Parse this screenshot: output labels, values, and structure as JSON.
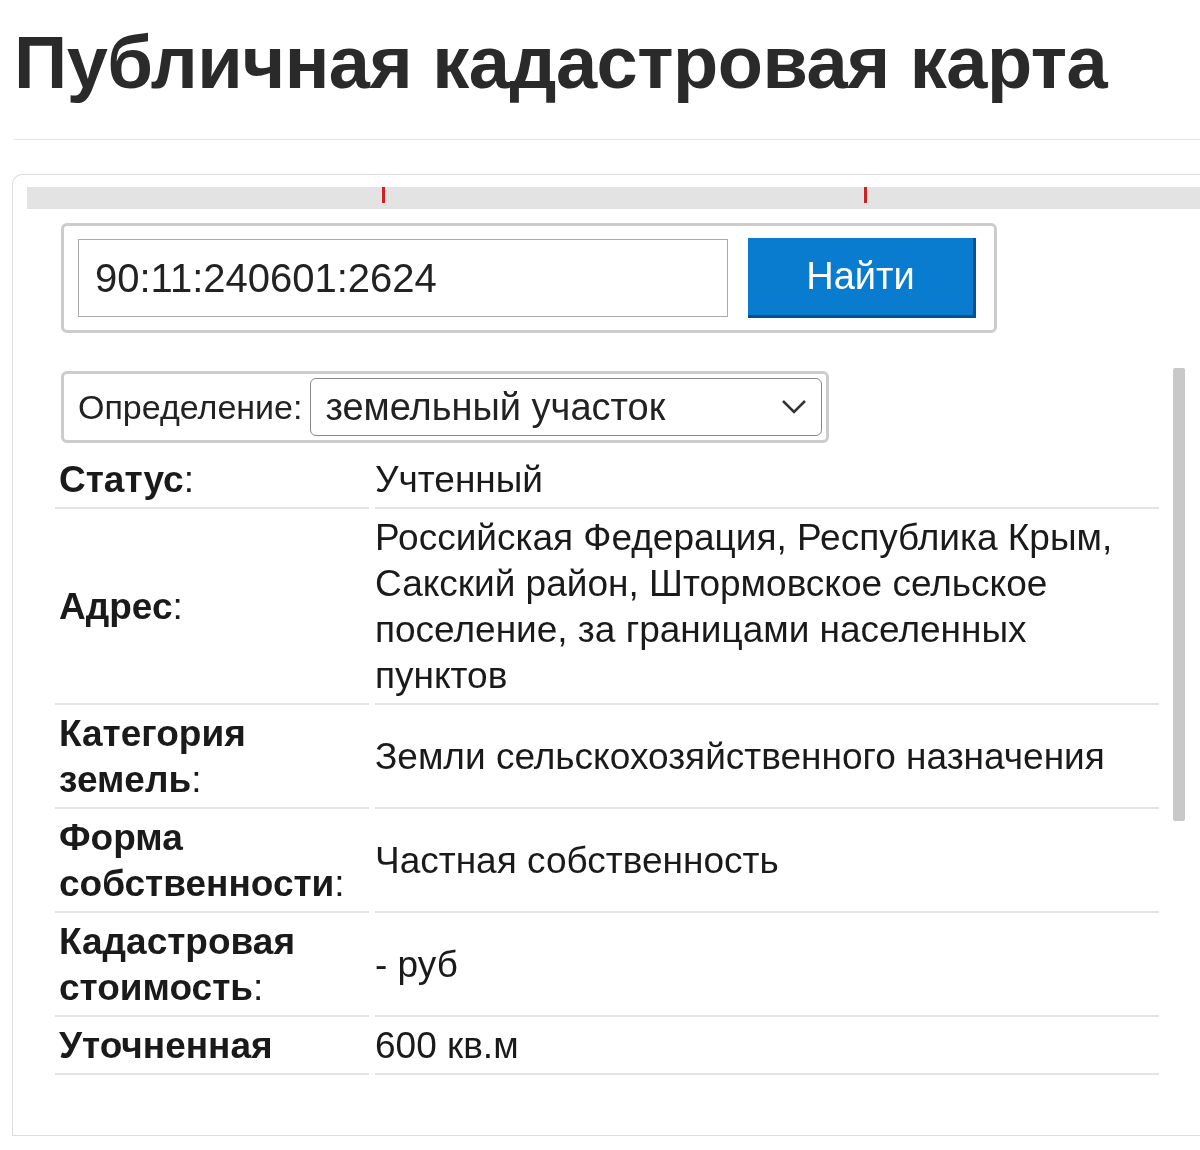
{
  "page": {
    "title": "Публичная кадастровая карта"
  },
  "search": {
    "value": "90:11:240601:2624",
    "button": "Найти"
  },
  "definition": {
    "label": "Определение:",
    "value": "земельный участок"
  },
  "rows": [
    {
      "label": "**Статус**:",
      "value": "Учтенный"
    },
    {
      "label": "**Адрес**:",
      "value": "Российская Федерация, Республика Крым, Сакский район, Штормовское сельское поселение, за границами населенных пунктов"
    },
    {
      "label": "**Категория земель**:",
      "value": "Земли сельскохозяйственного назначения"
    },
    {
      "label": "**Форма собственности**:",
      "value": "Частная собственность"
    },
    {
      "label": "**Кадастровая стоимость**:",
      "value": "- руб"
    },
    {
      "label": "**Уточненная**",
      "value": "600 кв.м"
    }
  ]
}
